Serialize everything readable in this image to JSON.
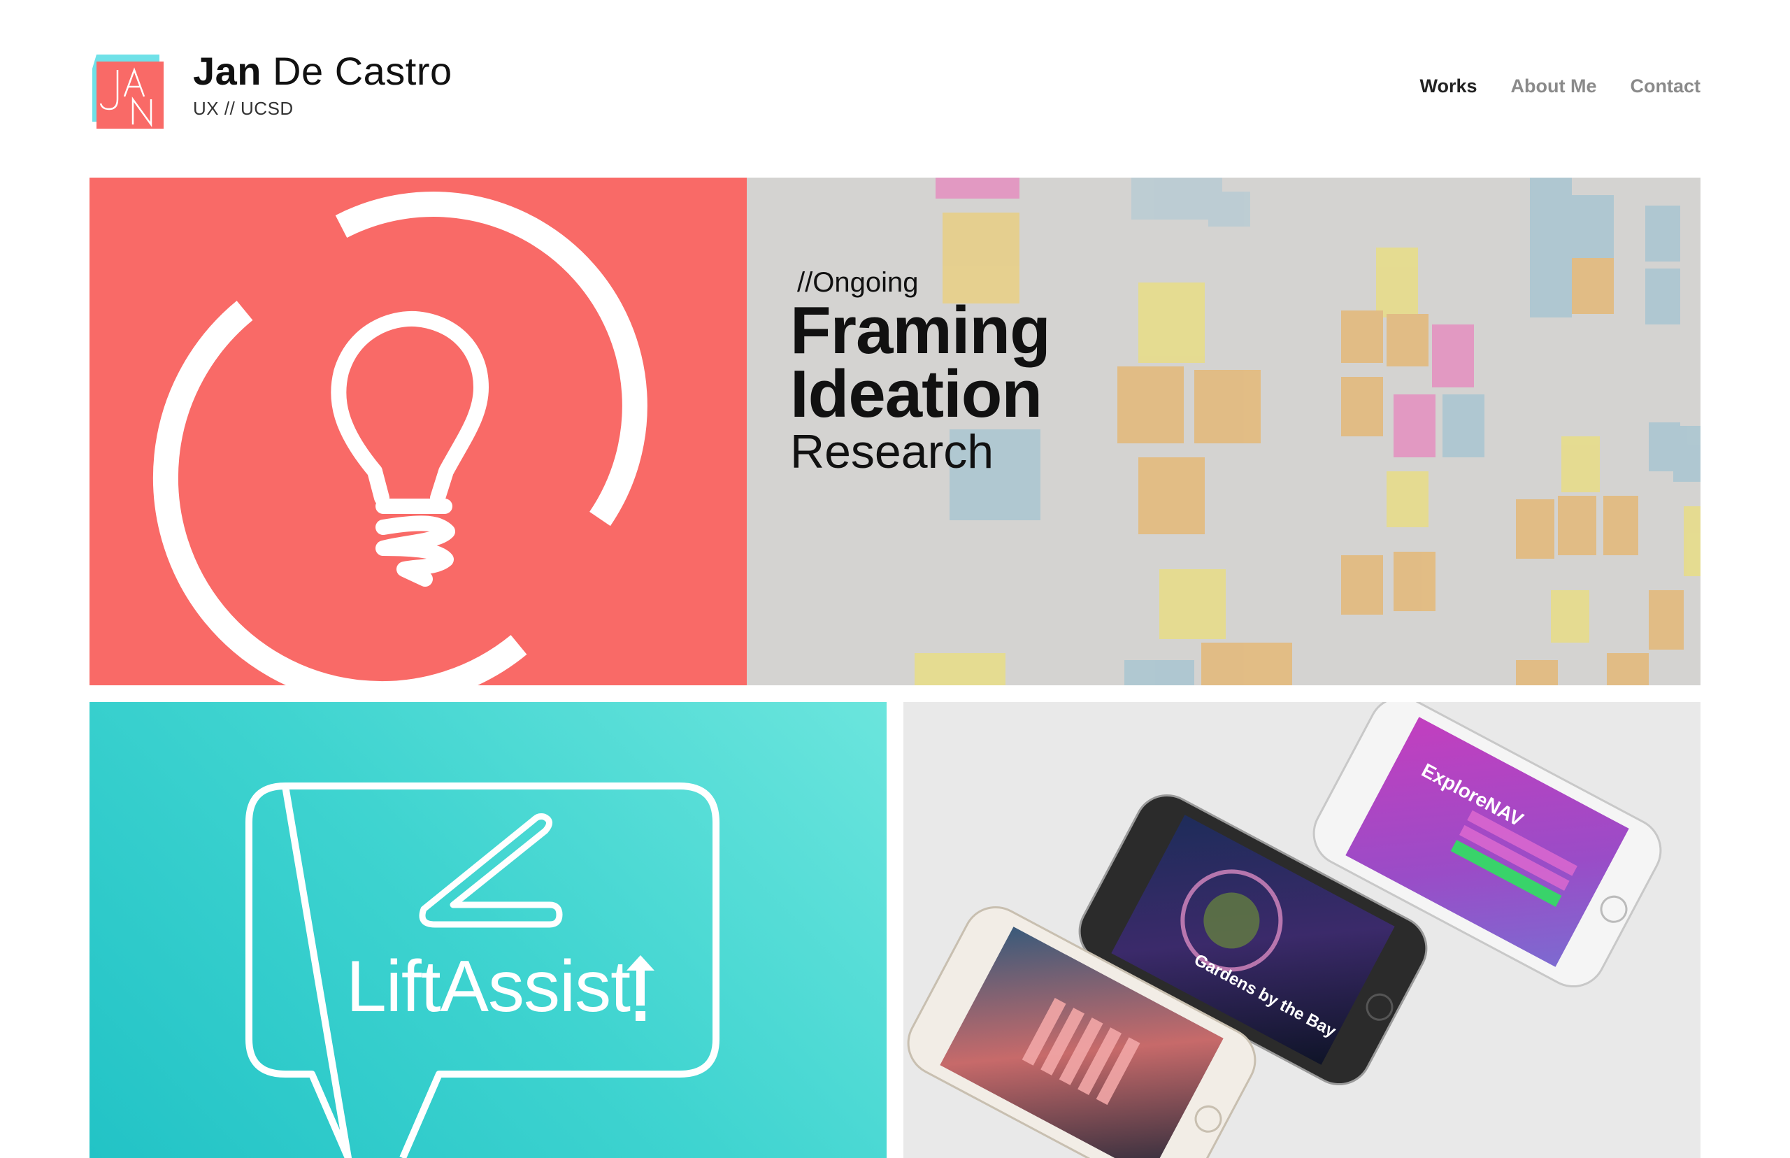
{
  "header": {
    "logo_letters": "JAN",
    "first_name": "Jan",
    "last_name": " De Castro",
    "subtitle": "UX // UCSD"
  },
  "nav": {
    "items": [
      {
        "label": "Works",
        "active": true
      },
      {
        "label": "About Me",
        "active": false
      },
      {
        "label": "Contact",
        "active": false
      }
    ]
  },
  "projects": {
    "hero": {
      "tag": "//Ongoing",
      "line1": "Framing",
      "line2": "Ideation",
      "line3": "Research",
      "accent": "#f96a67"
    },
    "lift": {
      "title": "LiftAssist",
      "accent": "#3fd4d0"
    },
    "explore": {
      "app_name": "ExploreNAV",
      "screen_caption": "Gardens by the Bay"
    }
  },
  "icons": [
    "logo-icon",
    "lightbulb-icon",
    "lift-arrow-icon",
    "speech-bubble-icon"
  ]
}
